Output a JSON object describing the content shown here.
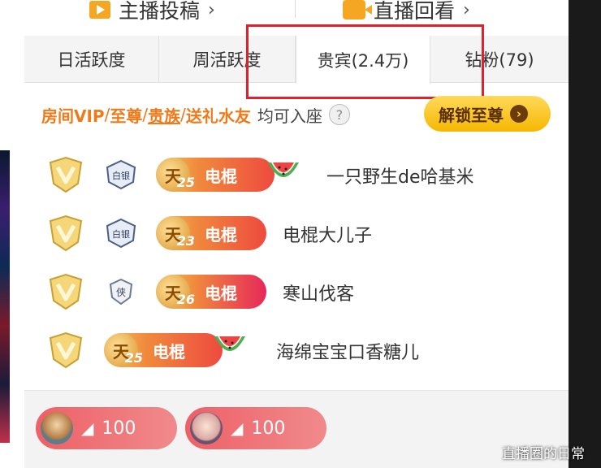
{
  "top_links": [
    {
      "label": "主播投稿",
      "icon": "video-play-icon"
    },
    {
      "label": "直播回看",
      "icon": "camera-icon"
    }
  ],
  "tabs": [
    {
      "label": "日活跃度"
    },
    {
      "label": "周活跃度"
    },
    {
      "label": "贵宾(2.4万)",
      "selected": true
    },
    {
      "label": "钻粉(79)"
    }
  ],
  "notice": {
    "parts": [
      "房间VIP",
      "至尊",
      "贵族",
      "送礼水友"
    ],
    "separator": "/",
    "suffix": "均可入座",
    "help": "?",
    "unlock_label": "解锁至尊",
    "unlock_arrow": "›"
  },
  "guests": [
    {
      "sky": "天",
      "level": "25",
      "badge": "电棍",
      "rank": "白银",
      "name": "一只野生de哈基米",
      "melon": true
    },
    {
      "sky": "天",
      "level": "23",
      "badge": "电棍",
      "rank": "白银",
      "name": "电棍大儿子",
      "melon": false
    },
    {
      "sky": "天",
      "level": "26",
      "badge": "电棍",
      "rank": "侠",
      "name": "寒山伐客",
      "melon": false
    },
    {
      "sky": "天",
      "level": "25",
      "badge": "电棍",
      "rank": "",
      "name": "海绵宝宝口香糖儿",
      "melon": true
    }
  ],
  "gifts": [
    {
      "count": "100"
    },
    {
      "count": "100"
    }
  ],
  "watermark": "直播圈的日常",
  "colors": {
    "accent": "#f07a19",
    "highlight_box": "#e0202a",
    "badge_start": "#f7c66b",
    "badge_end": "#ee4a3f"
  }
}
